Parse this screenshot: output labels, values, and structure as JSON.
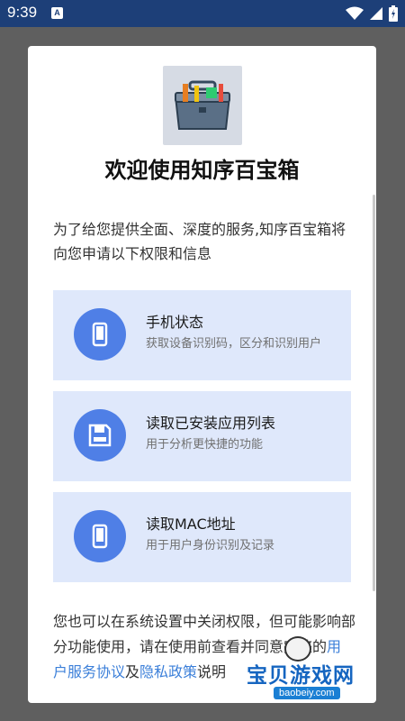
{
  "status_bar": {
    "time": "9:39",
    "notification_letter": "A"
  },
  "dialog": {
    "title": "欢迎使用知序百宝箱",
    "intro": "为了给您提供全面、深度的服务,知序百宝箱将向您申请以下权限和信息",
    "permissions": [
      {
        "title": "手机状态",
        "description": "获取设备识别码，区分和识别用户",
        "icon": "phone-icon"
      },
      {
        "title": "读取已安装应用列表",
        "description": "用于分析更快捷的功能",
        "icon": "floppy-disk-icon"
      },
      {
        "title": "读取MAC地址",
        "description": "用于用户身份识别及记录",
        "icon": "phone-icon"
      }
    ],
    "notice": {
      "text_before": "您也可以在系统设置中关闭权限，但可能影响部分功能使用，请在使用前查看并同意完整的",
      "user_agreement": "用户服务协议",
      "and": "及",
      "privacy_policy": "隐私政策",
      "text_after": "说明"
    }
  },
  "watermark": {
    "text": "宝贝游戏网",
    "url": "baobeiy.com"
  },
  "colors": {
    "status_bar": "#1d3f78",
    "accent": "#4f7fe6",
    "card_bg": "#dfe8fb",
    "link": "#3b7fd9"
  }
}
